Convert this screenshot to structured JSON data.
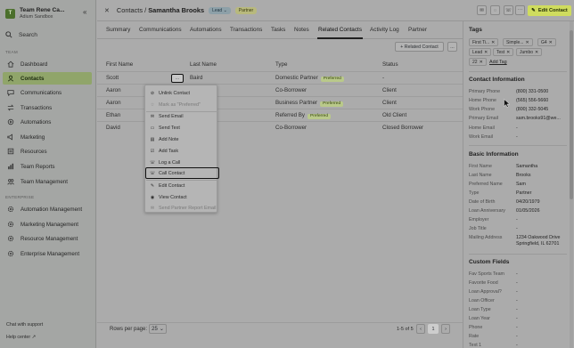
{
  "sidebar": {
    "brand_initial": "T",
    "brand_title": "Team Rene Ca...",
    "brand_subtitle": "Adium Sandbox",
    "search_label": "Search",
    "team_section": "TEAM",
    "team_items": [
      {
        "label": "Dashboard",
        "icon": "home-icon"
      },
      {
        "label": "Contacts",
        "icon": "contacts-icon",
        "active": true
      },
      {
        "label": "Communications",
        "icon": "chat-icon"
      },
      {
        "label": "Transactions",
        "icon": "transactions-icon"
      },
      {
        "label": "Automations",
        "icon": "automation-icon"
      },
      {
        "label": "Marketing",
        "icon": "marketing-icon"
      },
      {
        "label": "Resources",
        "icon": "resources-icon"
      },
      {
        "label": "Team Reports",
        "icon": "reports-icon"
      },
      {
        "label": "Team Management",
        "icon": "team-icon"
      }
    ],
    "enterprise_section": "ENTERPRISE",
    "enterprise_items": [
      {
        "label": "Automation Management",
        "icon": "gear-icon"
      },
      {
        "label": "Marketing Management",
        "icon": "gear-icon"
      },
      {
        "label": "Resource Management",
        "icon": "gear-icon"
      },
      {
        "label": "Enterprise Management",
        "icon": "gear-icon"
      }
    ],
    "chat_support": "Chat with support",
    "help_center": "Help center"
  },
  "header": {
    "breadcrumb_root": "Contacts",
    "separator": "/",
    "contact_name": "Samantha Brooks",
    "lead_pill": "Lead",
    "partner_pill": "Partner",
    "edit_button": "Edit Contact"
  },
  "tabs": [
    "Summary",
    "Communications",
    "Automations",
    "Transactions",
    "Tasks",
    "Notes",
    "Related Contacts",
    "Activity Log",
    "Partner"
  ],
  "active_tab": "Related Contacts",
  "toolbar": {
    "add_related": "+ Related Contact",
    "more": "..."
  },
  "table": {
    "columns": [
      "First Name",
      "Last Name",
      "Type",
      "Status"
    ],
    "rows": [
      {
        "first": "Scott",
        "last": "Baird",
        "type": "Domestic Partner",
        "badge": "Preferred",
        "status": "-"
      },
      {
        "first": "Aaron",
        "last": "",
        "type": "Co-Borrower",
        "badge": "",
        "status": "Client"
      },
      {
        "first": "Aaron",
        "last": "",
        "type": "Business Partner",
        "badge": "Preferred",
        "status": "Client"
      },
      {
        "first": "Ethan",
        "last": "",
        "type": "Referred By",
        "badge": "Preferred",
        "status": "Old Client"
      },
      {
        "first": "David",
        "last": "",
        "type": "Co-Borrower",
        "badge": "",
        "status": "Closed Borrower"
      }
    ],
    "row_action": "..."
  },
  "menu": {
    "items": [
      {
        "label": "Unlink Contact",
        "icon": "unlink-icon",
        "disabled": false
      },
      {
        "label": "Mark as \"Preferred\"",
        "icon": "star-icon",
        "disabled": true
      },
      {
        "label": "Send Email",
        "icon": "mail-icon",
        "disabled": false
      },
      {
        "label": "Send Text",
        "icon": "message-icon",
        "disabled": false
      },
      {
        "label": "Add Note",
        "icon": "note-icon",
        "disabled": false
      },
      {
        "label": "Add Task",
        "icon": "task-icon",
        "disabled": false
      },
      {
        "label": "Log a Call",
        "icon": "phone-icon",
        "disabled": false
      },
      {
        "label": "Call Contact",
        "icon": "phone-icon",
        "disabled": false,
        "highlighted": true
      },
      {
        "label": "Edit Contact",
        "icon": "edit-icon",
        "disabled": false
      },
      {
        "label": "View Contact",
        "icon": "eye-icon",
        "disabled": false
      },
      {
        "label": "Send Partner Report Email",
        "icon": "mail-icon",
        "disabled": true
      }
    ]
  },
  "pagination": {
    "rows_per_page_label": "Rows per page:",
    "rows_per_page": "25",
    "info": "1-5 of 5",
    "current_page": "1"
  },
  "right_panel": {
    "tags_title": "Tags",
    "tags": [
      "First Ti...",
      "Simple...",
      "G4",
      "Lead",
      "Test",
      "Jumbo",
      "22"
    ],
    "add_tag": "Add Tag",
    "contact_info_title": "Contact Information",
    "contact_info": [
      {
        "k": "Primary Phone",
        "v": "(800) 331-0500"
      },
      {
        "k": "Home Phone",
        "v": "(565) 556-5660"
      },
      {
        "k": "Work Phone",
        "v": "(800) 332-5045"
      },
      {
        "k": "Primary Email",
        "v": "sam.brooks91@we..."
      },
      {
        "k": "Home Email",
        "v": "-"
      },
      {
        "k": "Work Email",
        "v": "-"
      }
    ],
    "basic_info_title": "Basic Information",
    "basic_info": [
      {
        "k": "First Name",
        "v": "Samantha"
      },
      {
        "k": "Last Name",
        "v": "Brooks"
      },
      {
        "k": "Preferred Name",
        "v": "Sam"
      },
      {
        "k": "Type",
        "v": "Partner"
      },
      {
        "k": "Date of Birth",
        "v": "04/20/1979"
      },
      {
        "k": "Loan Anniversary",
        "v": "01/05/2026"
      },
      {
        "k": "Employer",
        "v": "-"
      },
      {
        "k": "Job Title",
        "v": "-"
      },
      {
        "k": "Mailing Address",
        "v": "1234 Oakwood Drive",
        "v2": "Springfield, IL 62701"
      }
    ],
    "custom_fields_title": "Custom Fields",
    "custom_fields": [
      {
        "k": "Fav Sports Team",
        "v": "-"
      },
      {
        "k": "Favorite Food",
        "v": "-"
      },
      {
        "k": "Loan Approval?",
        "v": "-"
      },
      {
        "k": "Loan Officer",
        "v": "-"
      },
      {
        "k": "Loan Type",
        "v": "-"
      },
      {
        "k": "Loan Year",
        "v": "-"
      },
      {
        "k": "Phone",
        "v": "-"
      },
      {
        "k": "Rate",
        "v": "-"
      },
      {
        "k": "Text 1",
        "v": "-"
      }
    ]
  },
  "colors": {
    "accent": "#cfdc5e",
    "nav_active": "#90a56a",
    "badge": "#b9c98a",
    "lead_pill": "#8da0a8",
    "partner_pill": "#b8b97d"
  }
}
